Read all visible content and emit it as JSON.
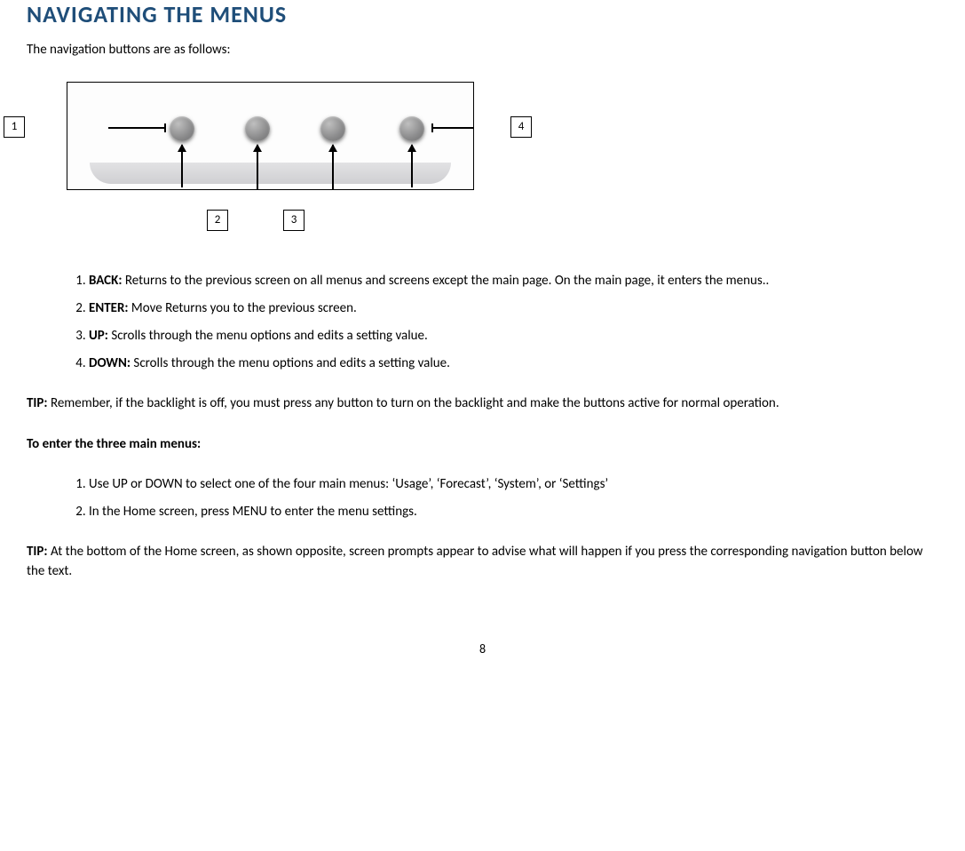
{
  "heading": "NAVIGATING THE MENUS",
  "intro": "The navigation buttons are as follows:",
  "callouts": {
    "c1": "1",
    "c2": "2",
    "c3": "3",
    "c4": "4"
  },
  "buttons_list": {
    "i1": {
      "name": "BACK:",
      "desc": " Returns to the previous screen on all menus and screens except the main page. On the main page, it enters the menus.."
    },
    "i2": {
      "name": "ENTER:",
      "desc": " Move Returns you to the previous screen."
    },
    "i3": {
      "name": "UP:",
      "desc": " Scrolls through the menu options and edits a setting value."
    },
    "i4": {
      "name": "DOWN:",
      "desc": " Scrolls through the menu options and edits a setting value."
    }
  },
  "tip1_label": "TIP:",
  "tip1_text": " Remember, if the backlight is off, you must press any button to turn on the backlight and make the buttons active for normal operation.",
  "subhead": "To enter the three main menus:",
  "steps": {
    "s1": "Use UP or DOWN to select one of the four main menus: ‘Usage’, ‘Forecast’, ‘System’, or ‘Settings’",
    "s2": "In the Home screen, press MENU to enter the menu settings."
  },
  "tip2_label": "TIP:",
  "tip2_text": " At the bottom of the Home screen, as shown opposite, screen prompts appear to advise what will happen if you press the corresponding navigation button below the text.",
  "page_number": "8"
}
